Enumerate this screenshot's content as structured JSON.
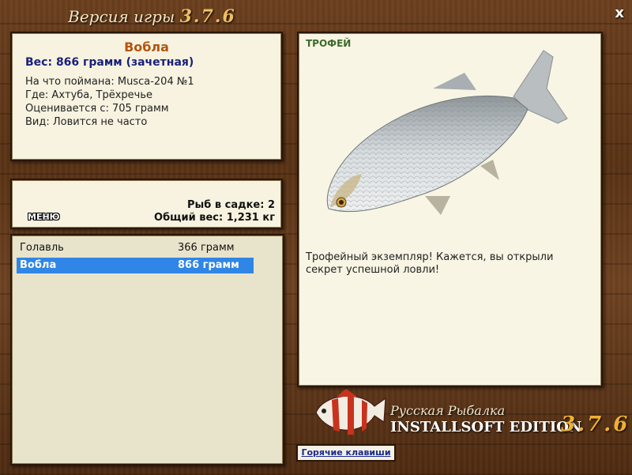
{
  "title": {
    "prefix": "Версия игры",
    "version": "3.7.6"
  },
  "close_label": "x",
  "info": {
    "fish_name": "Вобла",
    "weight": "Вес: 866 грамм (зачетная)",
    "bait": "На что поймана: Musca-204 №1",
    "location": "Где: Ахтуба, Трёхречье",
    "rated_from": "Оценивается с: 705 грамм",
    "kind": "Вид: Ловится не часто"
  },
  "keep": {
    "menu_label": "МЕНЮ",
    "fish_count": "Рыб в садке: 2",
    "total_weight": "Общий вес: 1,231 кг"
  },
  "catch_list": [
    {
      "name": "Голавль",
      "weight": "366 грамм",
      "selected": false
    },
    {
      "name": "Вобла",
      "weight": "866 грамм",
      "selected": true
    }
  ],
  "detail": {
    "badge": "ТРОФЕЙ",
    "description": "Трофейный экземпляр! Кажется, вы открыли секрет успешной ловли!"
  },
  "logo": {
    "line1": "Русская Рыбалка",
    "line2": "INSTALLSOFT EDITION",
    "version": "3.7.6"
  },
  "hotkeys_label": "Горячие клавиши",
  "colors": {
    "accent_orange": "#b4540e",
    "weight_blue": "#1a1f7a",
    "selection": "#2f86e6",
    "trophy_green": "#3d6b2a"
  }
}
